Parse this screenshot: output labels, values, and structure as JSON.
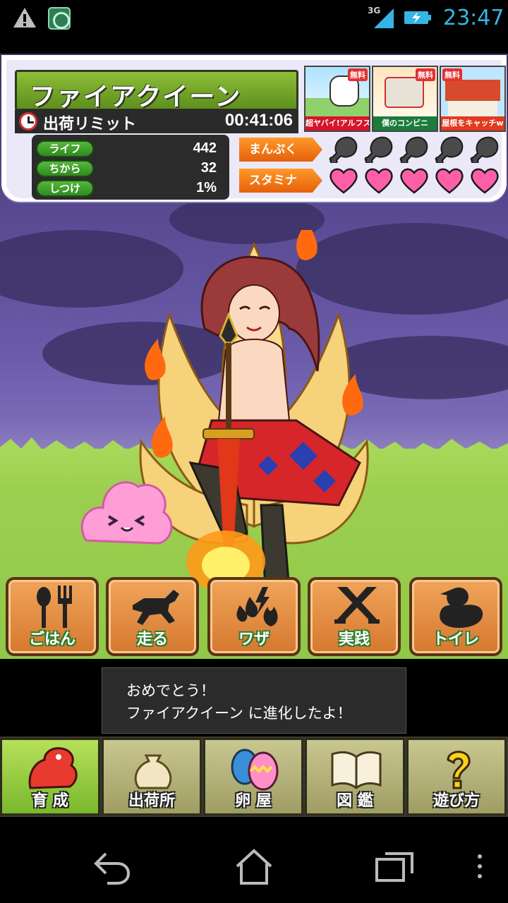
{
  "status_bar": {
    "network": "3G",
    "time": "23:47"
  },
  "pet": {
    "name": "ファイアクイーン",
    "limit_label": "出荷リミット",
    "limit_time": "00:41:06",
    "stats": [
      {
        "label": "ライフ",
        "value": "442"
      },
      {
        "label": "ちから",
        "value": "32"
      },
      {
        "label": "しつけ",
        "value": "1%"
      }
    ],
    "fullness": {
      "label": "まんぷく",
      "filled": 0,
      "max": 5
    },
    "stamina": {
      "label": "スタミナ",
      "filled": 5,
      "max": 5
    }
  },
  "ads": [
    {
      "badge": "無料",
      "caption": "超ヤバイ!アルフスの異変"
    },
    {
      "badge": "無料",
      "caption": "僕のコンビニ"
    },
    {
      "badge": "無料",
      "caption": "屋根をキャッチw"
    }
  ],
  "actions": [
    {
      "label": "ごはん",
      "icon": "spoon-fork-icon"
    },
    {
      "label": "走る",
      "icon": "running-dog-icon"
    },
    {
      "label": "ワザ",
      "icon": "elements-icon"
    },
    {
      "label": "実践",
      "icon": "crossed-swords-icon"
    },
    {
      "label": "トイレ",
      "icon": "duck-icon"
    }
  ],
  "toast": {
    "line1": "おめでとう！",
    "line2": "ファイアクイーン に進化したよ！"
  },
  "tabs": [
    {
      "label": "育 成",
      "icon": "dinosaur-icon",
      "active": true
    },
    {
      "label": "出荷所",
      "icon": "money-bag-icon",
      "active": false
    },
    {
      "label": "卵 屋",
      "icon": "eggs-icon",
      "active": false
    },
    {
      "label": "図 鑑",
      "icon": "book-icon",
      "active": false
    },
    {
      "label": "遊び方",
      "icon": "question-icon",
      "active": false
    }
  ],
  "colors": {
    "accent_time": "#36b5e5",
    "name_bar": "#6f9f25",
    "meter_label": "#f07a18",
    "heart": "#ff5fa8",
    "active_tab": "#8fcb3a"
  }
}
